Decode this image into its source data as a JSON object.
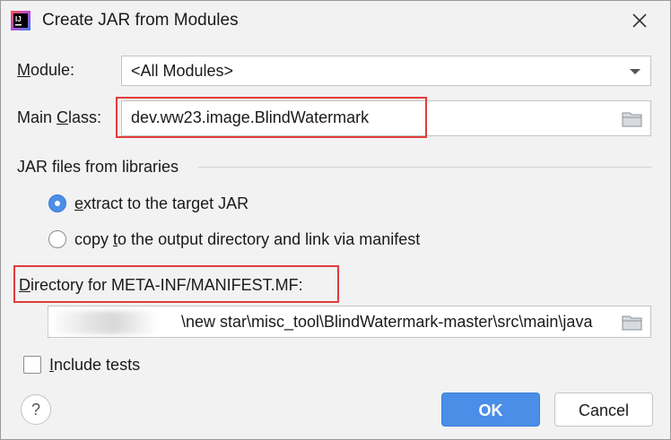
{
  "window": {
    "title": "Create JAR from Modules",
    "app_icon": "intellij-icon",
    "close_icon": "close-icon"
  },
  "module": {
    "label_prefix": "M",
    "label_rest": "odule:",
    "value": "<All Modules>"
  },
  "main_class": {
    "label_prefix": "Main ",
    "label_underlined": "C",
    "label_rest": "lass:",
    "value": "dev.ww23.image.BlindWatermark"
  },
  "jar_section": {
    "title": "JAR files from libraries",
    "options": [
      {
        "label_prefix": "",
        "label_underlined": "e",
        "label_rest": "xtract to the target JAR",
        "selected": true
      },
      {
        "label_prefix": "copy ",
        "label_underlined": "t",
        "label_rest": "o the output directory and link via manifest",
        "selected": false
      }
    ]
  },
  "manifest": {
    "label_prefix": "",
    "label_underlined": "D",
    "label_rest": "irectory for META-INF/MANIFEST.MF:",
    "value": "\\new star\\misc_tool\\BlindWatermark-master\\src\\main\\java"
  },
  "include_tests": {
    "label_prefix": "",
    "label_underlined": "I",
    "label_rest": "nclude tests",
    "checked": false
  },
  "buttons": {
    "help": "?",
    "ok": "OK",
    "cancel": "Cancel"
  },
  "colors": {
    "accent": "#4a8ee8",
    "highlight_box": "#e03c3c"
  }
}
